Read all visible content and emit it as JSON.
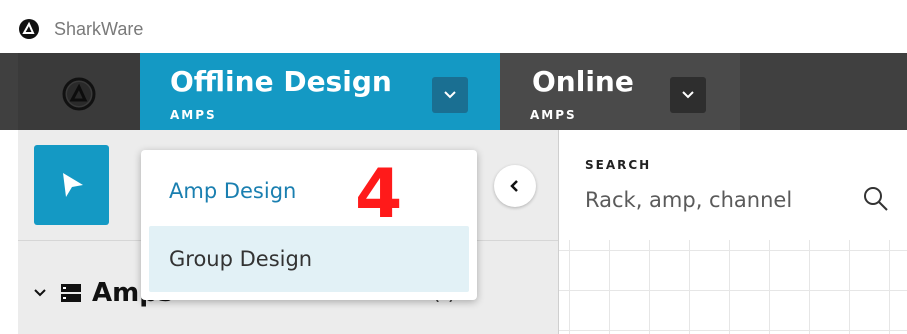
{
  "app": {
    "name": "SharkWare"
  },
  "tabs": [
    {
      "title": "Offline Design",
      "subtitle": "AMPS"
    },
    {
      "title": "Online",
      "subtitle": "AMPS"
    }
  ],
  "dropdown": {
    "items": [
      {
        "label": "Amp Design"
      },
      {
        "label": "Group Design"
      }
    ]
  },
  "annotation": {
    "step": "4"
  },
  "search": {
    "label": "SEARCH",
    "placeholder": "Rack, amp, channel"
  },
  "tree": {
    "label": "Amps",
    "count": "( )"
  },
  "colors": {
    "accent": "#1499c4",
    "topbar": "#404040",
    "marker": "#ff1a1a"
  },
  "icons": {
    "app_logo": "shark-logo-icon",
    "home": "shark-logo-icon",
    "tab_dropdown": "chevron-down-icon",
    "select_tool": "cursor-arrow-icon",
    "collapse": "chevron-left-icon",
    "search": "search-icon",
    "tree_expand": "chevron-down-icon",
    "tree_item": "amp-rack-icon"
  }
}
